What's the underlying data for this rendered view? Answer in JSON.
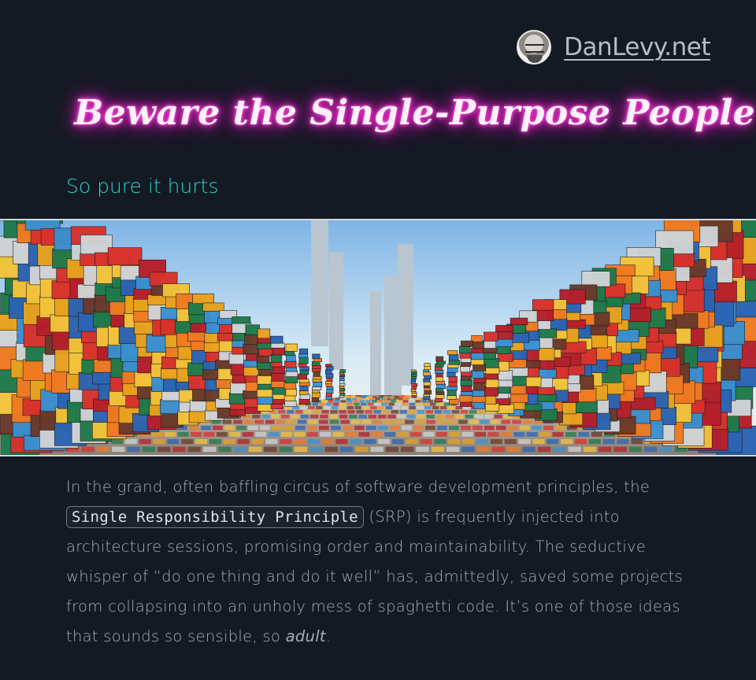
{
  "header": {
    "site_name": "DanLevy.net",
    "avatar": "author-avatar"
  },
  "post": {
    "title": "Beware the Single-Purpose People",
    "subtitle": "So pure it hurts",
    "hero_image": "colorful-brick-corridor-city",
    "paragraph": {
      "part1": "In the grand, often baffling circus of software development principles, the ",
      "code": "Single Responsibility Principle",
      "part2": " (SRP) is frequently injected into architecture sessions, promising order and maintainability. The seductive whisper of “do one thing and do it well” has, admittedly, saved some projects from collapsing into an unholy mess of spaghetti code. It’s one of those ideas that sounds so sensible, so ",
      "emphasis": "adult",
      "part3": "."
    }
  },
  "colors": {
    "background": "#131a23",
    "title_glow": "#ff2dd4",
    "subtitle": "#2ad4cc",
    "body_text": "#a7aeb8"
  }
}
